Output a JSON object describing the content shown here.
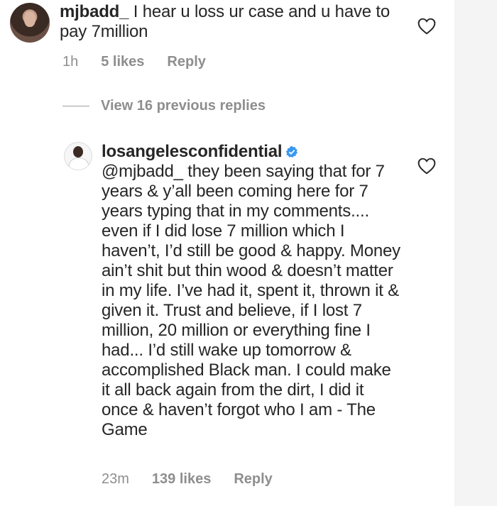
{
  "comments": [
    {
      "username": "mjbadd_",
      "text": " I hear u loss ur case and u have to pay 7million",
      "time": "1h",
      "likes": "5 likes",
      "reply": "Reply"
    },
    {
      "username": "losangelesconfidential",
      "verified": true,
      "text": "@mjbadd_ they been saying that for 7 years & y’all been coming here for 7 years typing that in my comments.... even if I did lose 7 million which I haven’t, I’d still be good & happy. Money ain’t shit but thin wood & doesn’t matter in my life. I’ve had it, spent it, thrown it & given it. Trust and believe, if I lost 7 million, 20 million or everything fine I had... I’d still wake up tomorrow & accomplished Black man. I could make it all back again from the dirt, I did it once & haven’t forgot who I am - The Game",
      "time": "23m",
      "likes": "139 likes",
      "reply": "Reply"
    }
  ],
  "view_replies": "View 16 previous replies",
  "icons": {
    "like": "heart-icon",
    "verified": "verified-badge-icon"
  },
  "colors": {
    "text": "#262626",
    "muted": "#8e8e8e",
    "verified": "#3897f0"
  }
}
